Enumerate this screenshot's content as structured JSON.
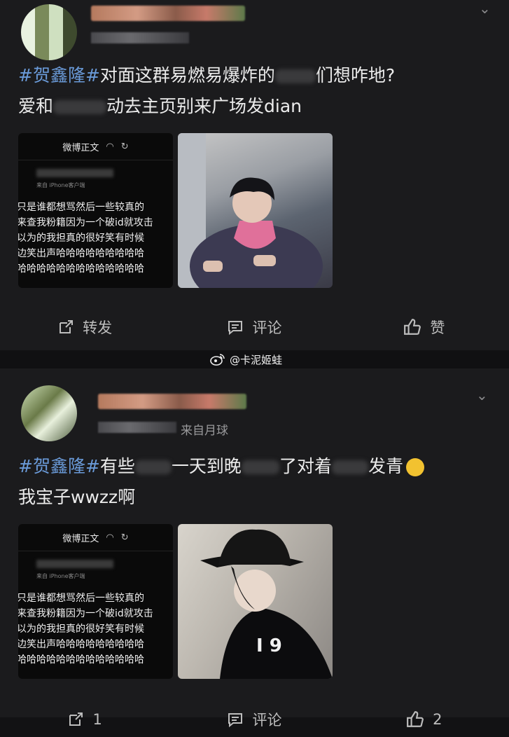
{
  "post1": {
    "meta_text": "",
    "hashtag": "#贺鑫隆#",
    "line1_rest_a": "对面这群易燃易爆炸的",
    "line1_rest_b": "们想咋地?",
    "line2_a": "爱和",
    "line2_b": "动去主页别来广场发",
    "line2_c": "dian",
    "shot": {
      "header": "微博正文",
      "source": "来自 iPhone客户端",
      "lines": [
        "只是谁都想骂然后一些较真的",
        "来查我粉籍因为一个破id就攻击",
        "以为的我担真的很好笑有时候",
        "边笑出声哈哈哈哈哈哈哈哈哈",
        "哈哈哈哈哈哈哈哈哈哈哈哈哈"
      ]
    },
    "actions": {
      "repost": "转发",
      "comment": "评论",
      "like": "赞"
    }
  },
  "watermark": "@卡泥姬蛙",
  "post2": {
    "meta_text": "来自月球",
    "hashtag": "#贺鑫隆#",
    "line1_a": "有些",
    "line1_b": "一天到晚",
    "line1_c": "了对着",
    "line1_d": "发青",
    "line2": "我宝子wwzz啊",
    "shot": {
      "header": "微博正文",
      "source": "来自 iPhone客户端",
      "lines": [
        "只是谁都想骂然后一些较真的",
        "来查我粉籍因为一个破id就攻击",
        "以为的我担真的很好笑有时候",
        "边笑出声哈哈哈哈哈哈哈哈哈",
        "哈哈哈哈哈哈哈哈哈哈哈哈哈"
      ]
    },
    "actions": {
      "repost": "1",
      "comment": "评论",
      "like": "2"
    }
  },
  "colors": {
    "hashtag": "#6a9ad8",
    "background": "#1b1b1d",
    "text": "#ececec"
  },
  "icons": [
    "chevron-down-icon",
    "repost-icon",
    "comment-icon",
    "like-icon",
    "weibo-logo-icon",
    "laugh-cry-emoji-icon"
  ]
}
